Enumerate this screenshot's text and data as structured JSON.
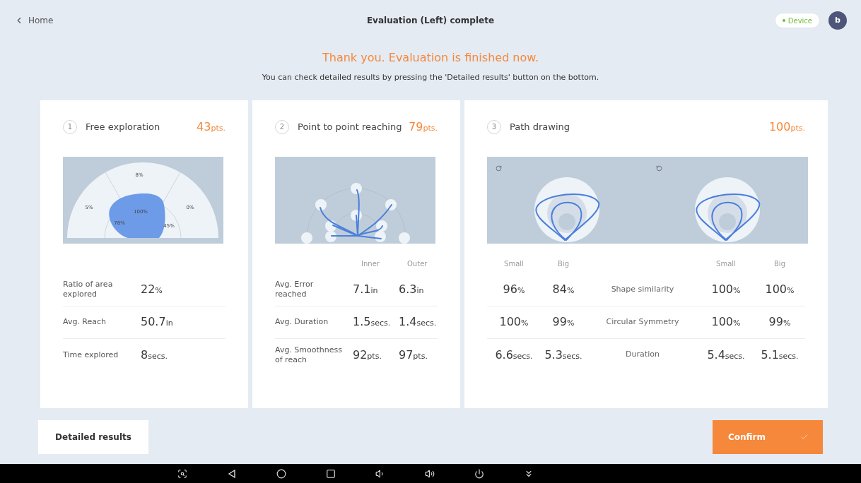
{
  "header": {
    "back_label": "Home",
    "title": "Evaluation (Left) complete",
    "device_status": "Device",
    "avatar_initial": "b"
  },
  "message": {
    "title": "Thank you. Evaluation is finished now.",
    "subtitle": "You can check detailed results by pressing the 'Detailed results' button on the bottom."
  },
  "cards": [
    {
      "kind": "exploration",
      "number": "1",
      "title": "Free exploration",
      "score": "43",
      "score_unit": "pts.",
      "sector_labels": [
        "8%",
        "5%",
        "100%",
        "0%",
        "78%",
        "45%"
      ],
      "rows": [
        {
          "label": "Ratio of area explored",
          "values": [
            {
              "value": "22",
              "unit": "%"
            }
          ]
        },
        {
          "label": "Avg. Reach",
          "values": [
            {
              "value": "50.7",
              "unit": "in"
            }
          ]
        },
        {
          "label": "Time explored",
          "values": [
            {
              "value": "8",
              "unit": "secs."
            }
          ]
        }
      ]
    },
    {
      "kind": "reaching",
      "number": "2",
      "title": "Point to point reaching",
      "score": "79",
      "score_unit": "pts.",
      "columns": [
        "Inner",
        "Outer"
      ],
      "rows": [
        {
          "label": "Avg. Error reached",
          "values": [
            {
              "value": "7.1",
              "unit": "in"
            },
            {
              "value": "6.3",
              "unit": "in"
            }
          ]
        },
        {
          "label": "Avg. Duration",
          "values": [
            {
              "value": "1.5",
              "unit": "secs."
            },
            {
              "value": "1.4",
              "unit": "secs."
            }
          ]
        },
        {
          "label": "Avg. Smoothness of reach",
          "values": [
            {
              "value": "92",
              "unit": "pts."
            },
            {
              "value": "97",
              "unit": "pts."
            }
          ]
        }
      ]
    },
    {
      "kind": "paths",
      "number": "3",
      "title": "Path drawing",
      "score": "100",
      "score_unit": "pts.",
      "columns": [
        "Small",
        "Big",
        "Small",
        "Big"
      ],
      "rows": [
        {
          "label": "Shape similarity",
          "values": [
            {
              "value": "96",
              "unit": "%"
            },
            {
              "value": "84",
              "unit": "%"
            },
            {
              "value": "100",
              "unit": "%"
            },
            {
              "value": "100",
              "unit": "%"
            }
          ]
        },
        {
          "label": "Circular Symmetry",
          "values": [
            {
              "value": "100",
              "unit": "%"
            },
            {
              "value": "99",
              "unit": "%"
            },
            {
              "value": "100",
              "unit": "%"
            },
            {
              "value": "99",
              "unit": "%"
            }
          ]
        },
        {
          "label": "Duration",
          "values": [
            {
              "value": "6.6",
              "unit": "secs."
            },
            {
              "value": "5.3",
              "unit": "secs."
            },
            {
              "value": "5.4",
              "unit": "secs."
            },
            {
              "value": "5.1",
              "unit": "secs."
            }
          ]
        }
      ]
    }
  ],
  "footer": {
    "details_button": "Detailed results",
    "confirm_button": "Confirm"
  }
}
